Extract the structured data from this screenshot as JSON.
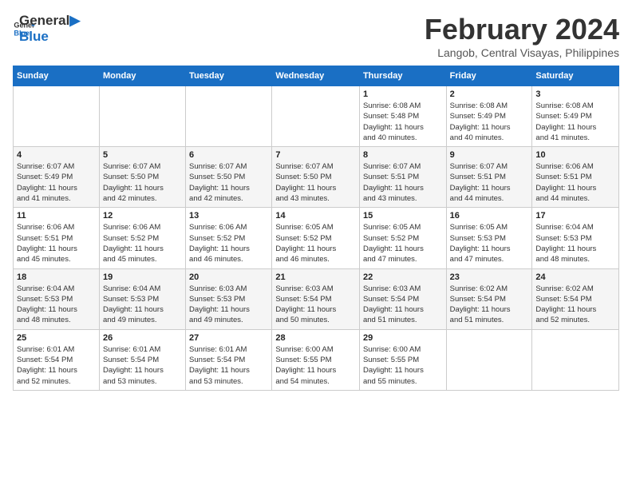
{
  "header": {
    "logo_line1": "General",
    "logo_line2": "Blue",
    "month_title": "February 2024",
    "location": "Langob, Central Visayas, Philippines"
  },
  "days_of_week": [
    "Sunday",
    "Monday",
    "Tuesday",
    "Wednesday",
    "Thursday",
    "Friday",
    "Saturday"
  ],
  "weeks": [
    [
      {
        "day": "",
        "info": ""
      },
      {
        "day": "",
        "info": ""
      },
      {
        "day": "",
        "info": ""
      },
      {
        "day": "",
        "info": ""
      },
      {
        "day": "1",
        "info": "Sunrise: 6:08 AM\nSunset: 5:48 PM\nDaylight: 11 hours\nand 40 minutes."
      },
      {
        "day": "2",
        "info": "Sunrise: 6:08 AM\nSunset: 5:49 PM\nDaylight: 11 hours\nand 40 minutes."
      },
      {
        "day": "3",
        "info": "Sunrise: 6:08 AM\nSunset: 5:49 PM\nDaylight: 11 hours\nand 41 minutes."
      }
    ],
    [
      {
        "day": "4",
        "info": "Sunrise: 6:07 AM\nSunset: 5:49 PM\nDaylight: 11 hours\nand 41 minutes."
      },
      {
        "day": "5",
        "info": "Sunrise: 6:07 AM\nSunset: 5:50 PM\nDaylight: 11 hours\nand 42 minutes."
      },
      {
        "day": "6",
        "info": "Sunrise: 6:07 AM\nSunset: 5:50 PM\nDaylight: 11 hours\nand 42 minutes."
      },
      {
        "day": "7",
        "info": "Sunrise: 6:07 AM\nSunset: 5:50 PM\nDaylight: 11 hours\nand 43 minutes."
      },
      {
        "day": "8",
        "info": "Sunrise: 6:07 AM\nSunset: 5:51 PM\nDaylight: 11 hours\nand 43 minutes."
      },
      {
        "day": "9",
        "info": "Sunrise: 6:07 AM\nSunset: 5:51 PM\nDaylight: 11 hours\nand 44 minutes."
      },
      {
        "day": "10",
        "info": "Sunrise: 6:06 AM\nSunset: 5:51 PM\nDaylight: 11 hours\nand 44 minutes."
      }
    ],
    [
      {
        "day": "11",
        "info": "Sunrise: 6:06 AM\nSunset: 5:51 PM\nDaylight: 11 hours\nand 45 minutes."
      },
      {
        "day": "12",
        "info": "Sunrise: 6:06 AM\nSunset: 5:52 PM\nDaylight: 11 hours\nand 45 minutes."
      },
      {
        "day": "13",
        "info": "Sunrise: 6:06 AM\nSunset: 5:52 PM\nDaylight: 11 hours\nand 46 minutes."
      },
      {
        "day": "14",
        "info": "Sunrise: 6:05 AM\nSunset: 5:52 PM\nDaylight: 11 hours\nand 46 minutes."
      },
      {
        "day": "15",
        "info": "Sunrise: 6:05 AM\nSunset: 5:52 PM\nDaylight: 11 hours\nand 47 minutes."
      },
      {
        "day": "16",
        "info": "Sunrise: 6:05 AM\nSunset: 5:53 PM\nDaylight: 11 hours\nand 47 minutes."
      },
      {
        "day": "17",
        "info": "Sunrise: 6:04 AM\nSunset: 5:53 PM\nDaylight: 11 hours\nand 48 minutes."
      }
    ],
    [
      {
        "day": "18",
        "info": "Sunrise: 6:04 AM\nSunset: 5:53 PM\nDaylight: 11 hours\nand 48 minutes."
      },
      {
        "day": "19",
        "info": "Sunrise: 6:04 AM\nSunset: 5:53 PM\nDaylight: 11 hours\nand 49 minutes."
      },
      {
        "day": "20",
        "info": "Sunrise: 6:03 AM\nSunset: 5:53 PM\nDaylight: 11 hours\nand 49 minutes."
      },
      {
        "day": "21",
        "info": "Sunrise: 6:03 AM\nSunset: 5:54 PM\nDaylight: 11 hours\nand 50 minutes."
      },
      {
        "day": "22",
        "info": "Sunrise: 6:03 AM\nSunset: 5:54 PM\nDaylight: 11 hours\nand 51 minutes."
      },
      {
        "day": "23",
        "info": "Sunrise: 6:02 AM\nSunset: 5:54 PM\nDaylight: 11 hours\nand 51 minutes."
      },
      {
        "day": "24",
        "info": "Sunrise: 6:02 AM\nSunset: 5:54 PM\nDaylight: 11 hours\nand 52 minutes."
      }
    ],
    [
      {
        "day": "25",
        "info": "Sunrise: 6:01 AM\nSunset: 5:54 PM\nDaylight: 11 hours\nand 52 minutes."
      },
      {
        "day": "26",
        "info": "Sunrise: 6:01 AM\nSunset: 5:54 PM\nDaylight: 11 hours\nand 53 minutes."
      },
      {
        "day": "27",
        "info": "Sunrise: 6:01 AM\nSunset: 5:54 PM\nDaylight: 11 hours\nand 53 minutes."
      },
      {
        "day": "28",
        "info": "Sunrise: 6:00 AM\nSunset: 5:55 PM\nDaylight: 11 hours\nand 54 minutes."
      },
      {
        "day": "29",
        "info": "Sunrise: 6:00 AM\nSunset: 5:55 PM\nDaylight: 11 hours\nand 55 minutes."
      },
      {
        "day": "",
        "info": ""
      },
      {
        "day": "",
        "info": ""
      }
    ]
  ]
}
